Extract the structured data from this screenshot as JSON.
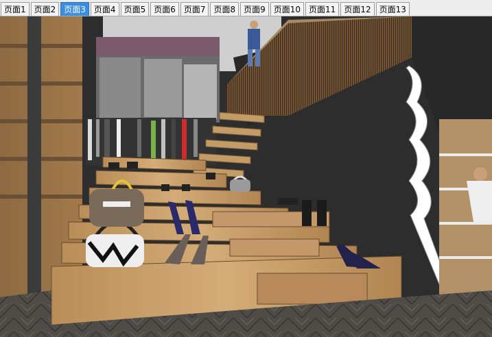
{
  "tabs": [
    {
      "label": "页面1",
      "active": false
    },
    {
      "label": "页面2",
      "active": false
    },
    {
      "label": "页面3",
      "active": true
    },
    {
      "label": "页面4",
      "active": false
    },
    {
      "label": "页面5",
      "active": false
    },
    {
      "label": "页面6",
      "active": false
    },
    {
      "label": "页面7",
      "active": false
    },
    {
      "label": "页面8",
      "active": false
    },
    {
      "label": "页面9",
      "active": false
    },
    {
      "label": "页面10",
      "active": false
    },
    {
      "label": "页面11",
      "active": false
    },
    {
      "label": "页面12",
      "active": false
    },
    {
      "label": "页面13",
      "active": false
    }
  ],
  "colors": {
    "active_tab": "#3b8ee0",
    "wall_dark": "#2b2b2b",
    "wood": "#c9a06b",
    "floor": "#4a4744"
  }
}
